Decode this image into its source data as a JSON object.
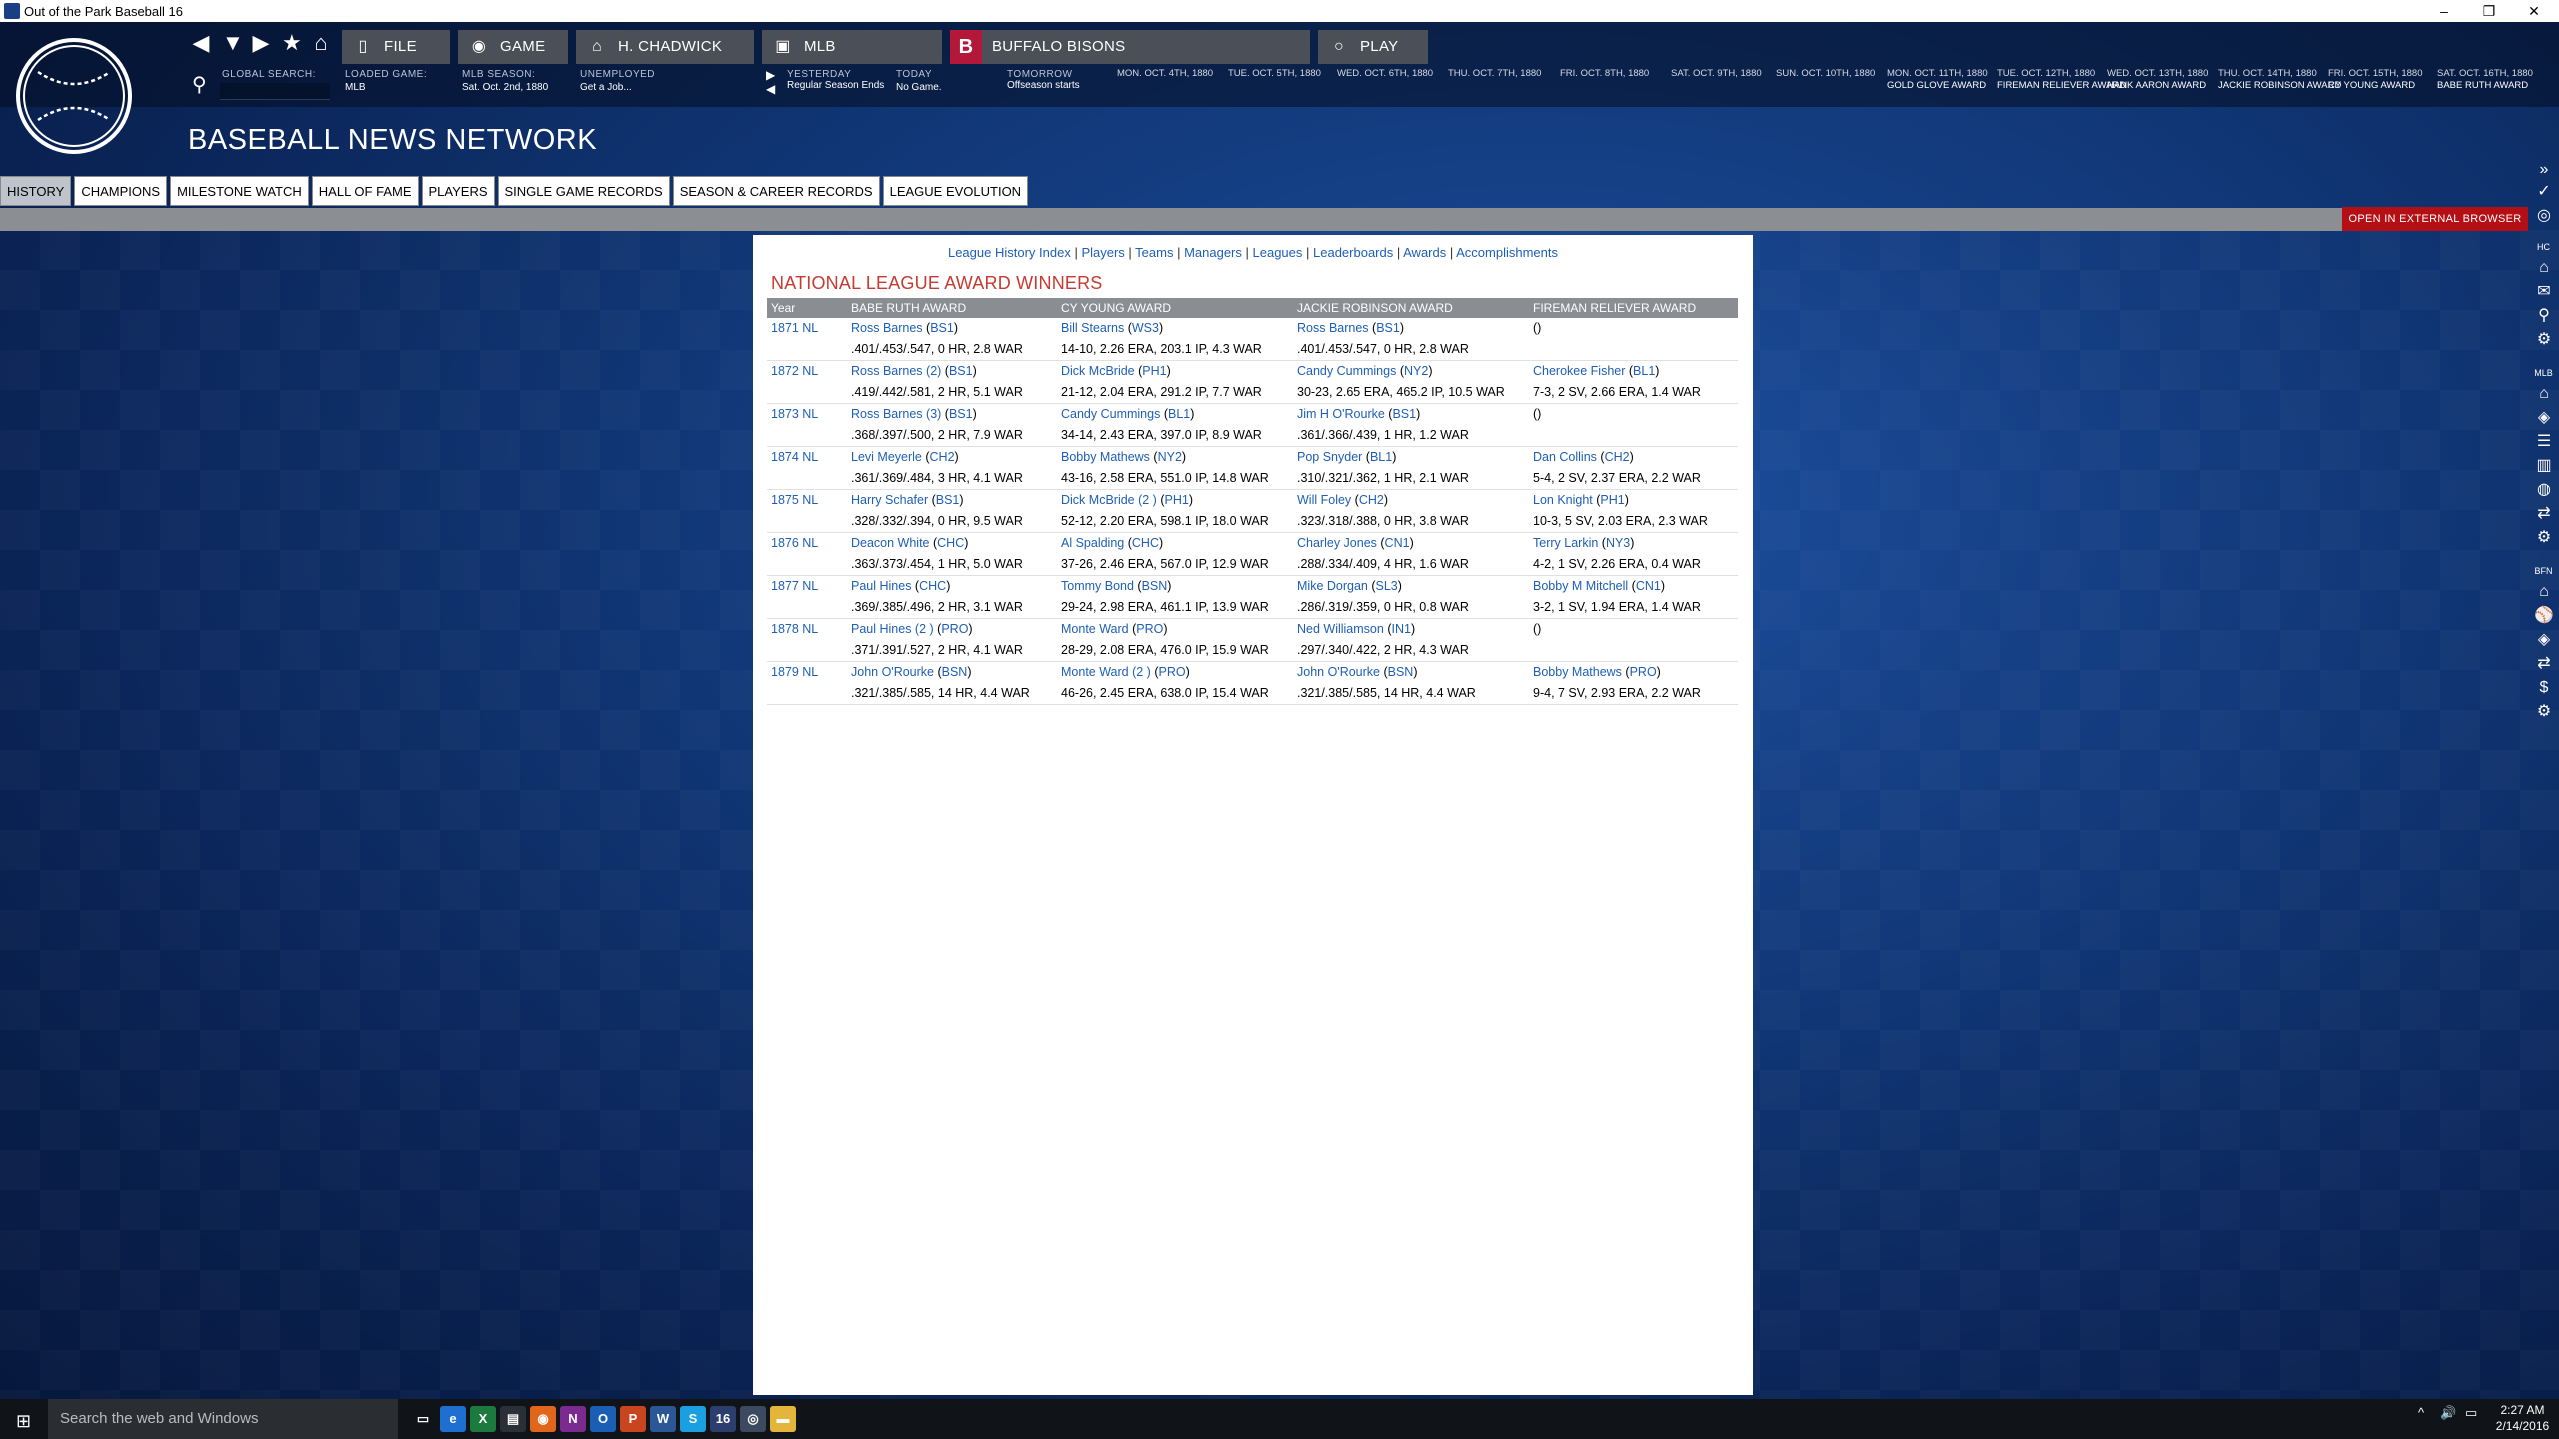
{
  "window": {
    "title": "Out of the Park Baseball 16",
    "minimize": "–",
    "restore": "❐",
    "close": "✕"
  },
  "toolbar": {
    "nav_icons": [
      "◀",
      "▼",
      "▶",
      "★",
      "⌂"
    ],
    "search_icon": "⚲",
    "buttons": [
      {
        "label": "FILE",
        "icon": "▯"
      },
      {
        "label": "GAME",
        "icon": "◉"
      },
      {
        "label": "H. CHADWICK",
        "icon": "⌂"
      },
      {
        "label": "MLB",
        "icon": "▣"
      },
      {
        "label": "BUFFALO BISONS",
        "icon": "B"
      },
      {
        "label": "PLAY",
        "icon": "○"
      }
    ]
  },
  "info": {
    "global_search_label": "GLOBAL SEARCH:",
    "loaded_game_label": "LOADED GAME:",
    "loaded_game": "MLB",
    "season_label": "MLB SEASON:",
    "season": "Sat. Oct. 2nd, 1880",
    "unemployed_label": "UNEMPLOYED",
    "unemployed": "Get a Job...",
    "yesterday_label": "YESTERDAY",
    "yesterday": "Regular Season Ends",
    "today_label": "TODAY",
    "today": "No Game.",
    "tomorrow_label": "TOMORROW",
    "tomorrow": "Offseason starts"
  },
  "calendar": {
    "dates": [
      "MON. OCT. 4TH, 1880",
      "TUE. OCT. 5TH, 1880",
      "WED. OCT. 6TH, 1880",
      "THU. OCT. 7TH, 1880",
      "FRI. OCT. 8TH, 1880",
      "SAT. OCT. 9TH, 1880",
      "SUN. OCT. 10TH, 1880",
      "MON. OCT. 11TH, 1880",
      "TUE. OCT. 12TH, 1880",
      "WED. OCT. 13TH, 1880",
      "THU. OCT. 14TH, 1880",
      "FRI. OCT. 15TH, 1880",
      "SAT. OCT. 16TH, 1880"
    ],
    "events": [
      "GOLD GLOVE AWARD",
      "FIREMAN RELIEVER AWARD",
      "HANK AARON AWARD",
      "JACKIE ROBINSON AWARD",
      "CY YOUNG AWARD",
      "BABE RUTH AWARD"
    ]
  },
  "page_title": "BASEBALL NEWS NETWORK",
  "tabs": [
    "HISTORY",
    "CHAMPIONS",
    "MILESTONE WATCH",
    "HALL OF FAME",
    "PLAYERS",
    "SINGLE GAME RECORDS",
    "SEASON & CAREER RECORDS",
    "LEAGUE EVOLUTION"
  ],
  "external_button": "OPEN IN EXTERNAL BROWSER",
  "sidebar": {
    "collapse_icon": "»",
    "labels": {
      "hc": "HC",
      "mlb": "MLB",
      "bfn": "BFN"
    },
    "icons": [
      "✓",
      "◎",
      "⌂",
      "✉",
      "⚲",
      "⚙",
      "⌂",
      "◈",
      "☰",
      "▥",
      "◍",
      "⇄",
      "⚙",
      "⌂",
      "⚾",
      "◈",
      "⇄",
      "$",
      "⚙"
    ]
  },
  "content": {
    "links": [
      "League History Index",
      "Players",
      "Teams",
      "Managers",
      "Leagues",
      "Leaderboards",
      "Awards",
      "Accomplishments"
    ],
    "heading": "NATIONAL LEAGUE AWARD WINNERS",
    "columns": [
      "Year",
      "BABE RUTH AWARD",
      "CY YOUNG AWARD",
      "JACKIE ROBINSON AWARD",
      "FIREMAN RELIEVER AWARD"
    ],
    "rows": [
      {
        "year": "1871 NL",
        "awards": [
          {
            "name": "Ross Barnes",
            "team": "BS1",
            "stats": ".401/.453/.547, 0 HR, 2.8 WAR"
          },
          {
            "name": "Bill Stearns",
            "team": "WS3",
            "stats": "14-10, 2.26 ERA, 203.1 IP, 4.3 WAR"
          },
          {
            "name": "Ross Barnes",
            "team": "BS1",
            "stats": ".401/.453/.547, 0 HR, 2.8 WAR"
          },
          {
            "name": "",
            "team": "",
            "stats": ""
          }
        ]
      },
      {
        "year": "1872 NL",
        "awards": [
          {
            "name": "Ross Barnes (2)",
            "team": "BS1",
            "stats": ".419/.442/.581, 2 HR, 5.1 WAR"
          },
          {
            "name": "Dick McBride",
            "team": "PH1",
            "stats": "21-12, 2.04 ERA, 291.2 IP, 7.7 WAR"
          },
          {
            "name": "Candy Cummings",
            "team": "NY2",
            "stats": "30-23, 2.65 ERA, 465.2 IP, 10.5 WAR"
          },
          {
            "name": "Cherokee Fisher",
            "team": "BL1",
            "stats": "7-3, 2 SV, 2.66 ERA, 1.4 WAR"
          }
        ]
      },
      {
        "year": "1873 NL",
        "awards": [
          {
            "name": "Ross Barnes (3)",
            "team": "BS1",
            "stats": ".368/.397/.500, 2 HR, 7.9 WAR"
          },
          {
            "name": "Candy Cummings",
            "team": "BL1",
            "stats": "34-14, 2.43 ERA, 397.0 IP, 8.9 WAR"
          },
          {
            "name": "Jim H O'Rourke",
            "team": "BS1",
            "stats": ".361/.366/.439, 1 HR, 1.2 WAR"
          },
          {
            "name": "",
            "team": "",
            "stats": ""
          }
        ]
      },
      {
        "year": "1874 NL",
        "awards": [
          {
            "name": "Levi Meyerle",
            "team": "CH2",
            "stats": ".361/.369/.484, 3 HR, 4.1 WAR"
          },
          {
            "name": "Bobby Mathews",
            "team": "NY2",
            "stats": "43-16, 2.58 ERA, 551.0 IP, 14.8 WAR"
          },
          {
            "name": "Pop Snyder",
            "team": "BL1",
            "stats": ".310/.321/.362, 1 HR, 2.1 WAR"
          },
          {
            "name": "Dan Collins",
            "team": "CH2",
            "stats": "5-4, 2 SV, 2.37 ERA, 2.2 WAR"
          }
        ]
      },
      {
        "year": "1875 NL",
        "awards": [
          {
            "name": "Harry Schafer",
            "team": "BS1",
            "stats": ".328/.332/.394, 0 HR, 9.5 WAR"
          },
          {
            "name": "Dick McBride (2 )",
            "team": "PH1",
            "stats": "52-12, 2.20 ERA, 598.1 IP, 18.0 WAR"
          },
          {
            "name": "Will Foley",
            "team": "CH2",
            "stats": ".323/.318/.388, 0 HR, 3.8 WAR"
          },
          {
            "name": "Lon Knight",
            "team": "PH1",
            "stats": "10-3, 5 SV, 2.03 ERA, 2.3 WAR"
          }
        ]
      },
      {
        "year": "1876 NL",
        "awards": [
          {
            "name": "Deacon White",
            "team": "CHC",
            "stats": ".363/.373/.454, 1 HR, 5.0 WAR"
          },
          {
            "name": "Al Spalding",
            "team": "CHC",
            "stats": "37-26, 2.46 ERA, 567.0 IP, 12.9 WAR"
          },
          {
            "name": "Charley Jones",
            "team": "CN1",
            "stats": ".288/.334/.409, 4 HR, 1.6 WAR"
          },
          {
            "name": "Terry Larkin",
            "team": "NY3",
            "stats": "4-2, 1 SV, 2.26 ERA, 0.4 WAR"
          }
        ]
      },
      {
        "year": "1877 NL",
        "awards": [
          {
            "name": "Paul Hines",
            "team": "CHC",
            "stats": ".369/.385/.496, 2 HR, 3.1 WAR"
          },
          {
            "name": "Tommy Bond",
            "team": "BSN",
            "stats": "29-24, 2.98 ERA, 461.1 IP, 13.9 WAR"
          },
          {
            "name": "Mike Dorgan",
            "team": "SL3",
            "stats": ".286/.319/.359, 0 HR, 0.8 WAR"
          },
          {
            "name": "Bobby M Mitchell",
            "team": "CN1",
            "stats": "3-2, 1 SV, 1.94 ERA, 1.4 WAR"
          }
        ]
      },
      {
        "year": "1878 NL",
        "awards": [
          {
            "name": "Paul Hines (2 )",
            "team": "PRO",
            "stats": ".371/.391/.527, 2 HR, 4.1 WAR"
          },
          {
            "name": "Monte Ward",
            "team": "PRO",
            "stats": "28-29, 2.08 ERA, 476.0 IP, 15.9 WAR"
          },
          {
            "name": "Ned Williamson",
            "team": "IN1",
            "stats": ".297/.340/.422, 2 HR, 4.3 WAR"
          },
          {
            "name": "",
            "team": "",
            "stats": ""
          }
        ]
      },
      {
        "year": "1879 NL",
        "awards": [
          {
            "name": "John O'Rourke",
            "team": "BSN",
            "stats": ".321/.385/.585, 14 HR, 4.4 WAR"
          },
          {
            "name": "Monte Ward (2 )",
            "team": "PRO",
            "stats": "46-26, 2.45 ERA, 638.0 IP, 15.4 WAR"
          },
          {
            "name": "John O'Rourke",
            "team": "BSN",
            "stats": ".321/.385/.585, 14 HR, 4.4 WAR"
          },
          {
            "name": "Bobby Mathews",
            "team": "PRO",
            "stats": "9-4, 7 SV, 2.93 ERA, 2.2 WAR"
          }
        ]
      }
    ]
  },
  "taskbar": {
    "search_placeholder": "Search the web and Windows",
    "apps": [
      {
        "name": "task-view",
        "glyph": "▭",
        "color": "#101418"
      },
      {
        "name": "edge",
        "glyph": "e",
        "color": "#1e6fd0"
      },
      {
        "name": "excel",
        "glyph": "X",
        "color": "#1d7a3e"
      },
      {
        "name": "store",
        "glyph": "▤",
        "color": "#2b2f36"
      },
      {
        "name": "firefox",
        "glyph": "◉",
        "color": "#e0661b"
      },
      {
        "name": "onenote",
        "glyph": "N",
        "color": "#7b2b8f"
      },
      {
        "name": "outlook",
        "glyph": "O",
        "color": "#1a5fb4"
      },
      {
        "name": "powerpoint",
        "glyph": "P",
        "color": "#c9451f"
      },
      {
        "name": "word",
        "glyph": "W",
        "color": "#2b5797"
      },
      {
        "name": "skype",
        "glyph": "S",
        "color": "#1aa0e0"
      },
      {
        "name": "ootp",
        "glyph": "16",
        "color": "#2c3e6e"
      },
      {
        "name": "app-disc",
        "glyph": "◎",
        "color": "#3b4a5e"
      },
      {
        "name": "explorer",
        "glyph": "▬",
        "color": "#e3b53a"
      }
    ],
    "tray": [
      "^",
      "🔊",
      "▭"
    ],
    "time": "2:27 AM",
    "date": "2/14/2016"
  }
}
